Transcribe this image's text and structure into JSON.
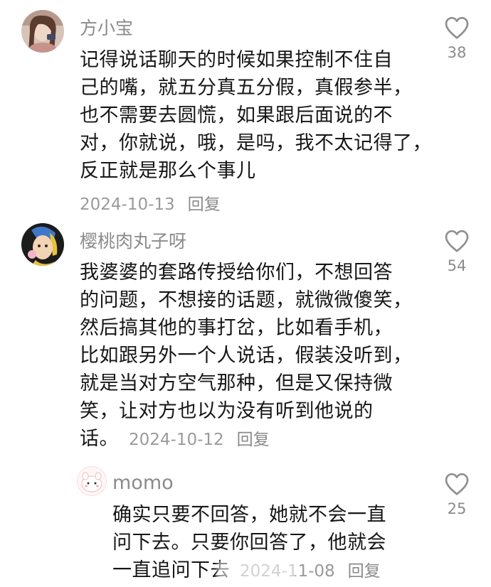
{
  "comments": [
    {
      "username": "方小宝",
      "lines": [
        "记得说话聊天的时候如果控制不住自",
        "己的嘴，就五分真五分假，真假参半，",
        "也不需要去圆慌，如果跟后面说的不",
        "对，你就说，哦，是吗，我不太记得了，",
        "反正就是那么个事儿"
      ],
      "date": "2024-10-13",
      "reply_label": "回复",
      "likes": "38",
      "icon": "heart-outline-icon"
    },
    {
      "username": "樱桃肉丸子呀",
      "lines": [
        "我婆婆的套路传授给你们，不想回答",
        "的问题，不想接的话题，就微微傻笑，",
        "然后搞其他的事打岔，比如看手机，",
        "比如跟另外一个人说话，假装没听到，",
        "就是当对方空气那种，但是又保持微",
        "笑，让对方也以为没有听到他说的",
        "话。"
      ],
      "date": "2024-10-12",
      "reply_label": "回复",
      "likes": "54",
      "icon": "heart-outline-icon"
    },
    {
      "username": "momo",
      "lines": [
        "确实只要不回答，她就不会一直",
        "问下去。只要你回答了，他就会",
        "一直追问下去"
      ],
      "date": "2024-11-08",
      "reply_label": "回复",
      "likes": "25",
      "icon": "heart-outline-icon"
    }
  ],
  "colors": {
    "username": "#8b8b8b",
    "body": "#161616",
    "meta": "#9a9a9a",
    "heart": "#8f8f8f",
    "background": "#ffffff"
  }
}
